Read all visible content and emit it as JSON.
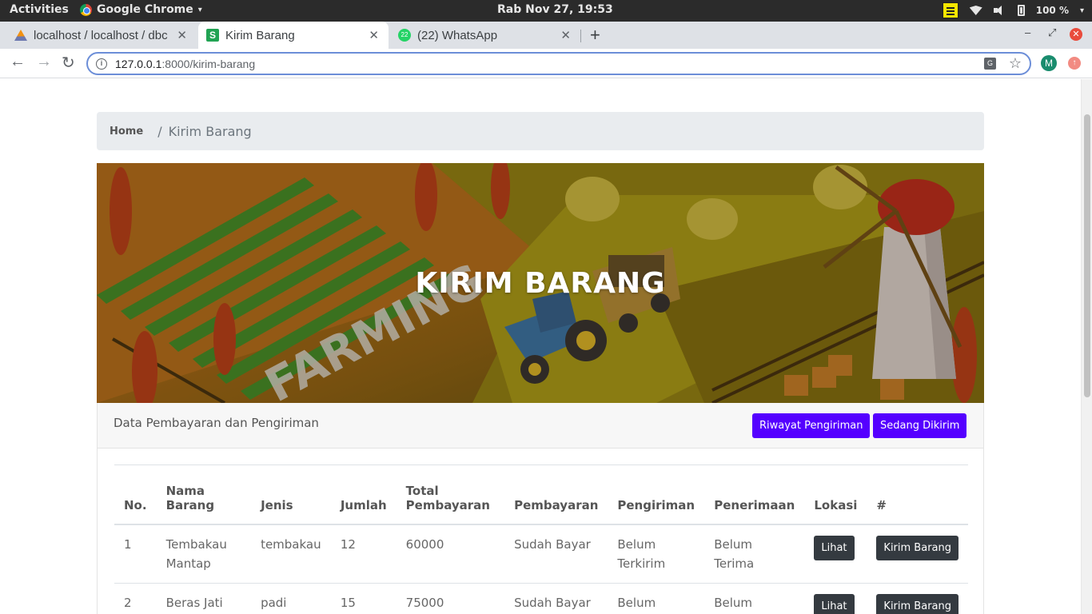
{
  "system": {
    "activities": "Activities",
    "app_name": "Google Chrome",
    "clock": "Rab Nov 27, 19:53",
    "battery": "100 %"
  },
  "tabs": [
    {
      "title": "localhost / localhost / dbc"
    },
    {
      "title": "Kirim Barang"
    },
    {
      "title": "(22) WhatsApp",
      "badge": "22"
    }
  ],
  "address": {
    "host": "127.0.0.1",
    "path": ":8000/kirim-barang"
  },
  "profile_initial": "M",
  "breadcrumb": {
    "home": "Home",
    "current": "Kirim Barang"
  },
  "hero": {
    "title": "KIRIM BARANG",
    "background_text": "FARMING"
  },
  "card": {
    "header_label": "Data Pembayaran dan Pengiriman",
    "history_button": "Riwayat Pengiriman",
    "shipping_button": "Sedang Dikirim"
  },
  "table": {
    "headers": [
      "No.",
      "Nama Barang",
      "Jenis",
      "Jumlah",
      "Total Pembayaran",
      "Pembayaran",
      "Pengiriman",
      "Penerimaan",
      "Lokasi",
      "#"
    ],
    "rows": [
      {
        "no": "1",
        "nama": "Tembakau Mantap",
        "jenis": "tembakau",
        "jumlah": "12",
        "total": "60000",
        "pembayaran": "Sudah Bayar",
        "pengiriman": "Belum Terkirim",
        "penerimaan": "Belum Terima",
        "lokasi_btn": "Lihat",
        "aksi_btn": "Kirim Barang"
      },
      {
        "no": "2",
        "nama": "Beras Jati",
        "jenis": "padi",
        "jumlah": "15",
        "total": "75000",
        "pembayaran": "Sudah Bayar",
        "pengiriman": "Belum",
        "penerimaan": "Belum",
        "lokasi_btn": "Lihat",
        "aksi_btn": "Kirim Barang"
      }
    ]
  },
  "colors": {
    "accent_purple": "#5500ff",
    "dark_button": "#343a40"
  }
}
